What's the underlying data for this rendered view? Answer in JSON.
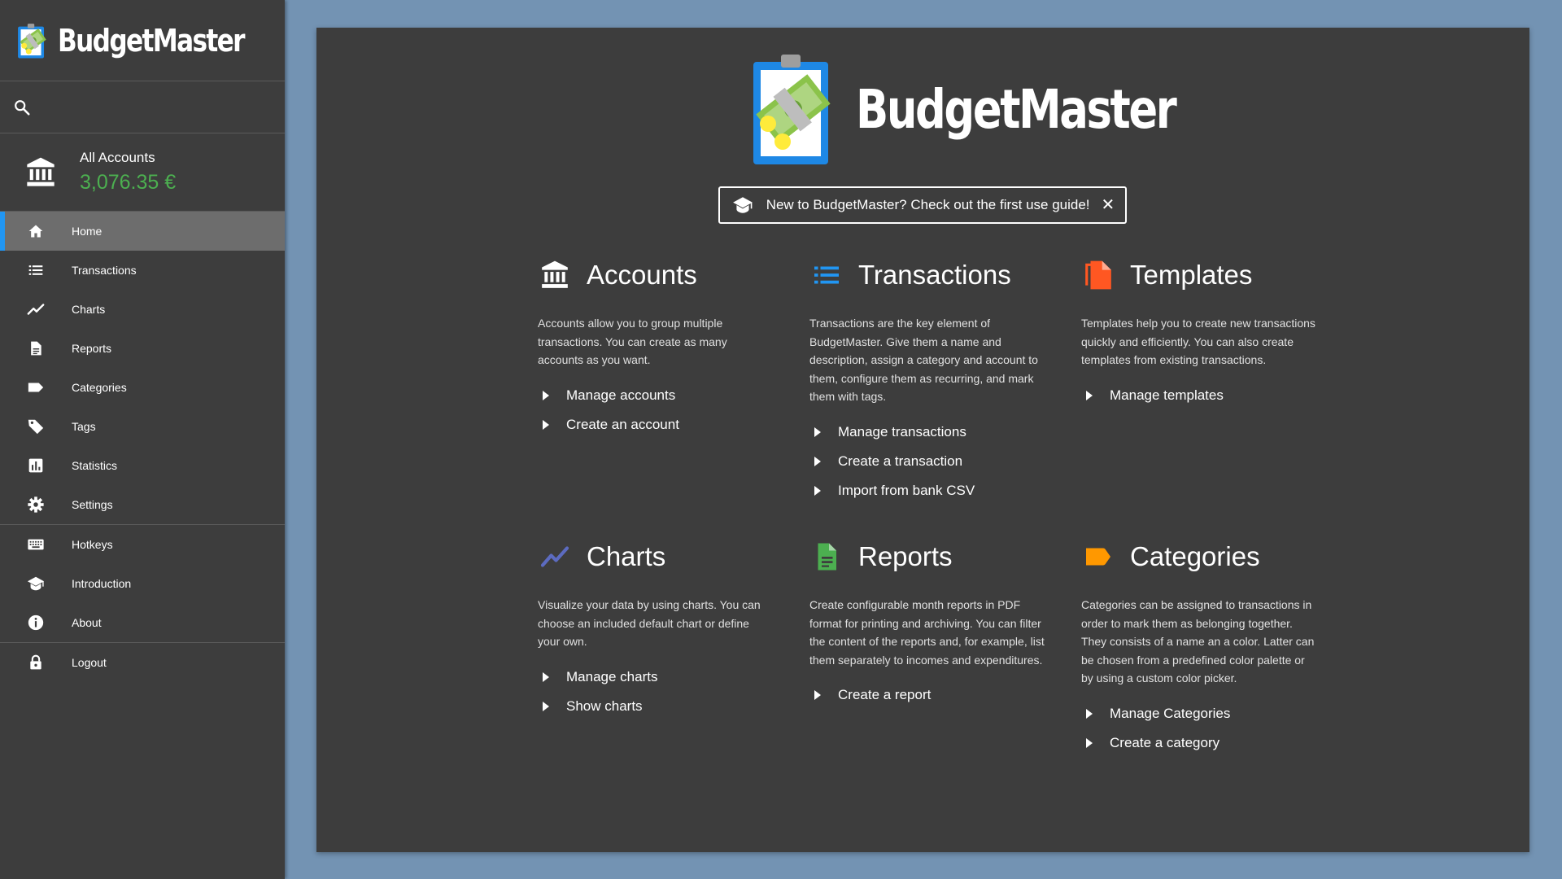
{
  "app": {
    "name": "BudgetMaster"
  },
  "sidebar": {
    "account": {
      "name": "All Accounts",
      "balance": "3,076.35 €"
    },
    "nav": [
      {
        "label": "Home",
        "icon": "home-icon",
        "active": true
      },
      {
        "label": "Transactions",
        "icon": "list-icon"
      },
      {
        "label": "Charts",
        "icon": "trend-icon"
      },
      {
        "label": "Reports",
        "icon": "document-icon"
      },
      {
        "label": "Categories",
        "icon": "label-icon"
      },
      {
        "label": "Tags",
        "icon": "tag-icon"
      },
      {
        "label": "Statistics",
        "icon": "bar-chart-icon"
      },
      {
        "label": "Settings",
        "icon": "gear-icon"
      },
      {
        "label": "Hotkeys",
        "icon": "keyboard-icon"
      },
      {
        "label": "Introduction",
        "icon": "graduation-cap-icon"
      },
      {
        "label": "About",
        "icon": "info-icon"
      },
      {
        "label": "Logout",
        "icon": "lock-icon"
      }
    ]
  },
  "banner": {
    "text": "New to BudgetMaster? Check out the first use guide!",
    "close": "✕"
  },
  "sections": {
    "accounts": {
      "title": "Accounts",
      "description": "Accounts allow you to group multiple transactions. You can create as many accounts as you want.",
      "links": [
        "Manage accounts",
        "Create an account"
      ]
    },
    "transactions": {
      "title": "Transactions",
      "description": "Transactions are the key element of BudgetMaster. Give them a name and description, assign a category and account to them, configure them as recurring, and mark them with tags.",
      "links": [
        "Manage transactions",
        "Create a transaction",
        "Import from bank CSV"
      ]
    },
    "templates": {
      "title": "Templates",
      "description": "Templates help you to create new transactions quickly and efficiently. You can also create templates from existing transactions.",
      "links": [
        "Manage templates"
      ]
    },
    "charts": {
      "title": "Charts",
      "description": "Visualize your data by using charts. You can choose an included default chart or define your own.",
      "links": [
        "Manage charts",
        "Show charts"
      ]
    },
    "reports": {
      "title": "Reports",
      "description": "Create configurable month reports in PDF format for printing and archiving. You can filter the content of the reports and, for example, list them separately to incomes and expenditures.",
      "links": [
        "Create a report"
      ]
    },
    "categories": {
      "title": "Categories",
      "description": "Categories can be assigned to transactions in order to mark them as belonging together. They consists of a name an a color. Latter can be chosen from a predefined color palette or by using a custom color picker.",
      "links": [
        "Manage Categories",
        "Create a category"
      ]
    }
  },
  "colors": {
    "background": "#7393b3",
    "panel": "#3d3d3d",
    "balance": "#4caf50",
    "active_indicator": "#2196f3",
    "transactions_icon": "#2196f3",
    "templates_icon": "#ff5722",
    "charts_icon": "#5c6bc0",
    "reports_icon": "#4caf50",
    "categories_icon": "#ff9800"
  }
}
